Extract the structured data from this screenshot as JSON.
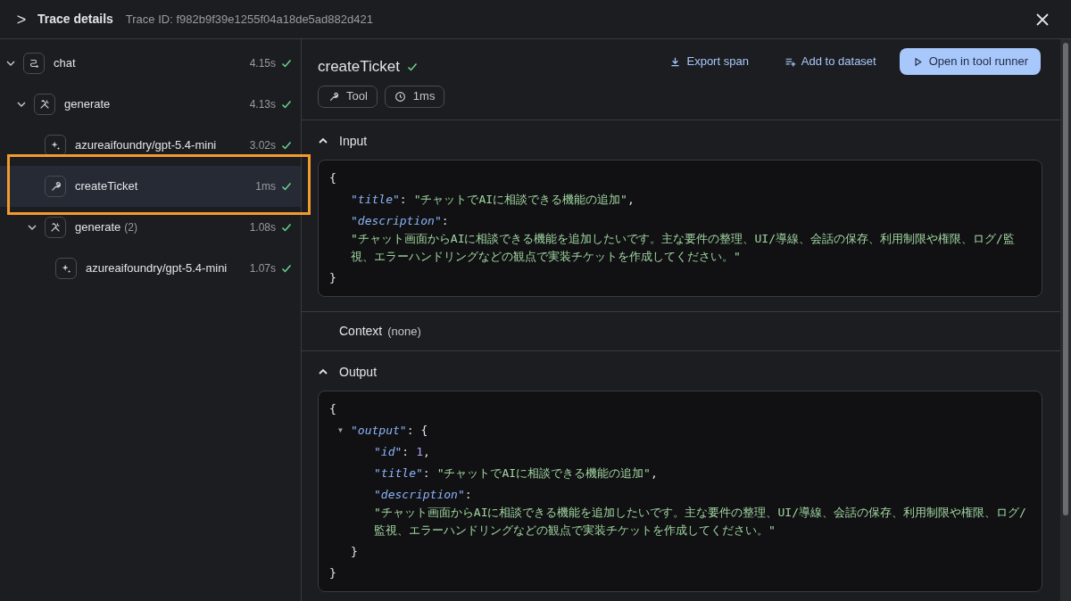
{
  "header": {
    "toggle": ">",
    "title": "Trace details",
    "trace_id": "Trace ID: f982b9f39e1255f04a18de5ad882d421"
  },
  "tree": [
    {
      "kind": "chain",
      "label": "chat",
      "duration": "4.15s",
      "ok": true,
      "expanded": true,
      "selected": false,
      "highlighted": false,
      "children": [
        {
          "kind": "generate",
          "label": "generate",
          "duration": "4.13s",
          "ok": true,
          "expanded": true,
          "selected": false,
          "highlighted": false,
          "children": [
            {
              "kind": "model",
              "label": "azureaifoundry/gpt-5.4-mini",
              "duration": "3.02s",
              "ok": true,
              "selected": false,
              "highlighted": false
            },
            {
              "kind": "tool",
              "label": "createTicket",
              "duration": "1ms",
              "ok": true,
              "selected": true,
              "highlighted": true
            },
            {
              "kind": "generate",
              "label": "generate",
              "count": "(2)",
              "duration": "1.08s",
              "ok": true,
              "expanded": true,
              "selected": false,
              "highlighted": false,
              "children": [
                {
                  "kind": "model",
                  "label": "azureaifoundry/gpt-5.4-mini",
                  "duration": "1.07s",
                  "ok": true,
                  "selected": false,
                  "highlighted": false
                }
              ]
            }
          ]
        }
      ]
    }
  ],
  "detail": {
    "title": "createTicket",
    "ok": true,
    "badges": [
      {
        "kind": "tool",
        "label": "Tool"
      },
      {
        "kind": "time",
        "label": "1ms"
      }
    ],
    "actions": [
      {
        "kind": "download",
        "label": "Export span",
        "primary": false
      },
      {
        "kind": "playlist",
        "label": "Add to dataset",
        "primary": false
      },
      {
        "kind": "play",
        "label": "Open in tool runner",
        "primary": true
      }
    ],
    "sections": [
      {
        "kind": "code",
        "label": "Input",
        "expanded": true,
        "code": {
          "open": "{",
          "close": "}",
          "entries": [
            {
              "key": "\"title\"",
              "sep": ":",
              "kind": "string",
              "value": "\"チャットでAIに相談できる機能の追加\"",
              "comma": ","
            },
            {
              "key": "\"description\"",
              "sep": ":",
              "kind": "block",
              "value": "\"チャット画面からAIに相談できる機能を追加したいです。主な要件の整理、UI/導線、会話の保存、利用制限や権限、ログ/監視、エラーハンドリングなどの観点で実装チケットを作成してください。\""
            }
          ]
        }
      },
      {
        "kind": "plain",
        "label": "Context",
        "note": "(none)"
      },
      {
        "kind": "code",
        "label": "Output",
        "expanded": true,
        "code": {
          "open": "{",
          "close": "}",
          "entries": [
            {
              "key": "\"output\"",
              "sep": ":",
              "kind": "object",
              "marker": "▼",
              "expanded": true,
              "open": "{",
              "close": "}",
              "entries": [
                {
                  "key": "\"id\"",
                  "sep": ":",
                  "kind": "number",
                  "value": "1",
                  "comma": ","
                },
                {
                  "key": "\"title\"",
                  "sep": ":",
                  "kind": "string",
                  "value": "\"チャットでAIに相談できる機能の追加\"",
                  "comma": ","
                },
                {
                  "key": "\"description\"",
                  "sep": ":",
                  "kind": "block",
                  "value": "\"チャット画面からAIに相談できる機能を追加したいです。主な要件の整理、UI/導線、会話の保存、利用制限や権限、ログ/監視、エラーハンドリングなどの観点で実装チケットを作成してください。\""
                }
              ]
            }
          ]
        }
      }
    ]
  }
}
